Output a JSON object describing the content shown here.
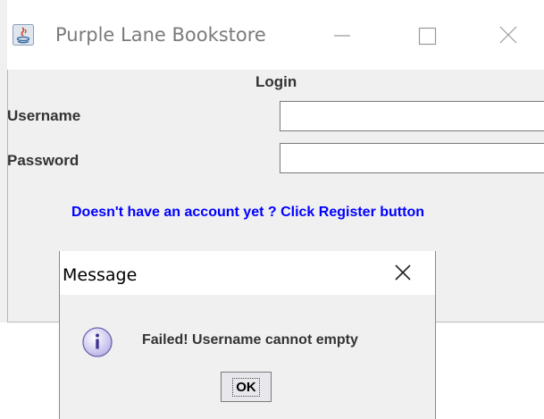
{
  "main_window": {
    "title": "Purple Lane Bookstore",
    "form_title": "Login",
    "username_label": "Username",
    "username_value": "",
    "password_label": "Password",
    "password_value": "",
    "register_hint": "Doesn't have an account yet ? Click Register button",
    "icons": [
      "java-icon",
      "minimize-icon",
      "maximize-icon",
      "close-icon"
    ],
    "colors": {
      "hint": "#0000ff",
      "background": "#f0f0f0"
    }
  },
  "dialog": {
    "title": "Message",
    "message": "Failed! Username cannot empty",
    "ok_label": "OK",
    "icons": [
      "info-icon",
      "close-icon"
    ]
  }
}
